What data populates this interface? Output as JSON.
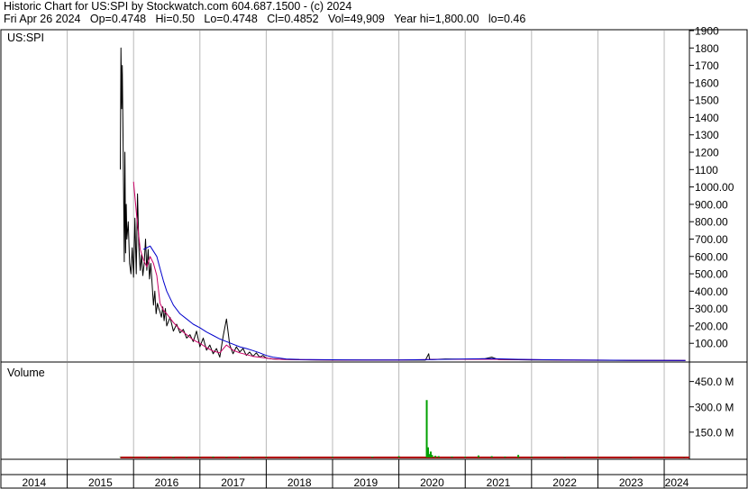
{
  "header": {
    "line1": "Historic Chart for US:SPI by Stockwatch.com 604.687.1500 - (c) 2024",
    "line2": "Fri Apr 26 2024   Op=0.4748   Hi=0.50   Lo=0.4748   Cl=0.4852   Vol=49,909   Year hi=1,800.00   lo=0.46"
  },
  "colors": {
    "price": "#000000",
    "ma_short": "#cc0066",
    "ma_long": "#0000cc",
    "volume": "#00a000",
    "volume_base": "#b00000",
    "grid": "#b8b8b8"
  },
  "chart_data": [
    {
      "type": "line",
      "title": "US:SPI",
      "y_ticks": [
        "1900",
        "1800",
        "1700",
        "1600",
        "1500",
        "1400",
        "1300",
        "1200",
        "1100",
        "1000.00",
        "900.00",
        "800.00",
        "700.00",
        "600.00",
        "500.00",
        "400.00",
        "300.00",
        "200.00",
        "100.00"
      ],
      "ylim": [
        0,
        1900
      ],
      "x_labels": [
        "2014",
        "2015",
        "2016",
        "2017",
        "2018",
        "2019",
        "2020",
        "2021",
        "2022",
        "2023",
        "2024"
      ],
      "grid": true,
      "series": [
        {
          "role": "price",
          "x": [
            2015.8,
            2015.81,
            2015.82,
            2015.83,
            2015.84,
            2015.85,
            2015.86,
            2015.87,
            2015.88,
            2015.89,
            2015.9,
            2015.92,
            2015.94,
            2015.96,
            2015.98,
            2016.0,
            2016.02,
            2016.04,
            2016.06,
            2016.08,
            2016.1,
            2016.12,
            2016.14,
            2016.16,
            2016.18,
            2016.2,
            2016.22,
            2016.24,
            2016.26,
            2016.28,
            2016.3,
            2016.32,
            2016.34,
            2016.36,
            2016.38,
            2016.4,
            2016.42,
            2016.44,
            2016.46,
            2016.48,
            2016.5,
            2016.55,
            2016.6,
            2016.65,
            2016.7,
            2016.75,
            2016.8,
            2016.85,
            2016.9,
            2016.95,
            2017.0,
            2017.05,
            2017.1,
            2017.15,
            2017.2,
            2017.25,
            2017.3,
            2017.35,
            2017.4,
            2017.45,
            2017.5,
            2017.55,
            2017.6,
            2017.65,
            2017.7,
            2017.75,
            2017.8,
            2017.85,
            2017.9,
            2017.95,
            2018.0,
            2018.1,
            2018.2,
            2018.35,
            2018.5,
            2018.75,
            2019.0,
            2019.5,
            2020.0,
            2020.4,
            2020.45,
            2020.46,
            2020.47,
            2020.5,
            2020.7,
            2021.0,
            2021.3,
            2021.4,
            2021.5,
            2021.8,
            2022.0,
            2022.5,
            2023.0,
            2023.5,
            2024.0,
            2024.32
          ],
          "values": [
            1100,
            1800,
            1450,
            1700,
            1350,
            950,
            570,
            1200,
            620,
            900,
            700,
            800,
            560,
            500,
            650,
            480,
            820,
            500,
            960,
            650,
            520,
            610,
            490,
            560,
            700,
            520,
            640,
            470,
            560,
            440,
            320,
            400,
            270,
            330,
            300,
            280,
            250,
            310,
            230,
            300,
            200,
            250,
            170,
            210,
            160,
            180,
            130,
            150,
            110,
            170,
            80,
            130,
            60,
            90,
            40,
            70,
            20,
            140,
            240,
            90,
            40,
            80,
            50,
            70,
            30,
            50,
            25,
            45,
            20,
            30,
            15,
            10,
            8,
            6,
            5,
            4,
            3,
            3,
            3,
            3,
            40,
            12,
            8,
            6,
            10,
            8,
            12,
            20,
            6,
            5,
            4,
            3,
            2,
            1.5,
            1,
            0.49
          ]
        },
        {
          "role": "short moving average",
          "x": [
            2016.0,
            2016.05,
            2016.1,
            2016.15,
            2016.2,
            2016.25,
            2016.3,
            2016.35,
            2016.4,
            2016.45,
            2016.5,
            2016.6,
            2016.7,
            2016.8,
            2016.9,
            2017.0,
            2017.1,
            2017.2,
            2017.3,
            2017.4,
            2017.5,
            2017.6,
            2017.7,
            2017.8,
            2017.9,
            2018.0,
            2018.1,
            2018.2,
            2018.4,
            2018.6,
            2019.0,
            2019.5,
            2020.0,
            2020.45,
            2020.6,
            2021.0,
            2021.4,
            2021.8,
            2022.5,
            2023.0,
            2023.5,
            2024.32
          ],
          "values": [
            1030,
            820,
            640,
            580,
            540,
            600,
            560,
            490,
            330,
            290,
            270,
            220,
            180,
            150,
            120,
            100,
            75,
            55,
            45,
            90,
            60,
            45,
            35,
            25,
            20,
            15,
            10,
            8,
            6,
            5,
            4,
            4,
            4,
            6,
            8,
            8,
            8,
            6,
            4,
            3,
            2,
            1
          ]
        },
        {
          "role": "long moving average",
          "x": [
            2016.15,
            2016.25,
            2016.35,
            2016.4,
            2016.45,
            2016.5,
            2016.6,
            2016.7,
            2016.8,
            2016.9,
            2017.0,
            2017.1,
            2017.2,
            2017.3,
            2017.4,
            2017.5,
            2017.6,
            2017.7,
            2017.8,
            2017.9,
            2018.0,
            2018.1,
            2018.3,
            2018.5,
            2019.0,
            2019.5,
            2020.0,
            2020.5,
            2021.0,
            2021.4,
            2021.8,
            2022.5,
            2023.5,
            2024.32
          ],
          "values": [
            640,
            660,
            600,
            530,
            460,
            400,
            320,
            270,
            240,
            210,
            190,
            165,
            145,
            125,
            110,
            95,
            80,
            70,
            58,
            45,
            30,
            20,
            10,
            7,
            5,
            4,
            4,
            6,
            10,
            12,
            8,
            4,
            2,
            1
          ]
        }
      ]
    },
    {
      "type": "bar",
      "title": "Volume",
      "y_ticks": [
        "450.0 M",
        "300.0 M",
        "150.0 M"
      ],
      "ylim": [
        0,
        560
      ],
      "unit": "M",
      "x": [
        2015.8,
        2016.0,
        2016.2,
        2016.4,
        2016.6,
        2016.8,
        2017.0,
        2017.2,
        2017.4,
        2017.6,
        2017.8,
        2018.0,
        2018.5,
        2019.0,
        2019.6,
        2020.0,
        2020.42,
        2020.44,
        2020.46,
        2020.48,
        2020.5,
        2020.55,
        2020.6,
        2020.8,
        2021.0,
        2021.2,
        2021.4,
        2021.6,
        2021.8,
        2022.0,
        2022.5,
        2023.0,
        2023.5,
        2024.0,
        2024.3
      ],
      "values": [
        2,
        3,
        4,
        3,
        5,
        4,
        3,
        6,
        4,
        5,
        3,
        4,
        3,
        4,
        5,
        8,
        340,
        60,
        20,
        35,
        15,
        10,
        8,
        6,
        5,
        12,
        8,
        6,
        15,
        4,
        3,
        3,
        2,
        2,
        2
      ]
    }
  ]
}
